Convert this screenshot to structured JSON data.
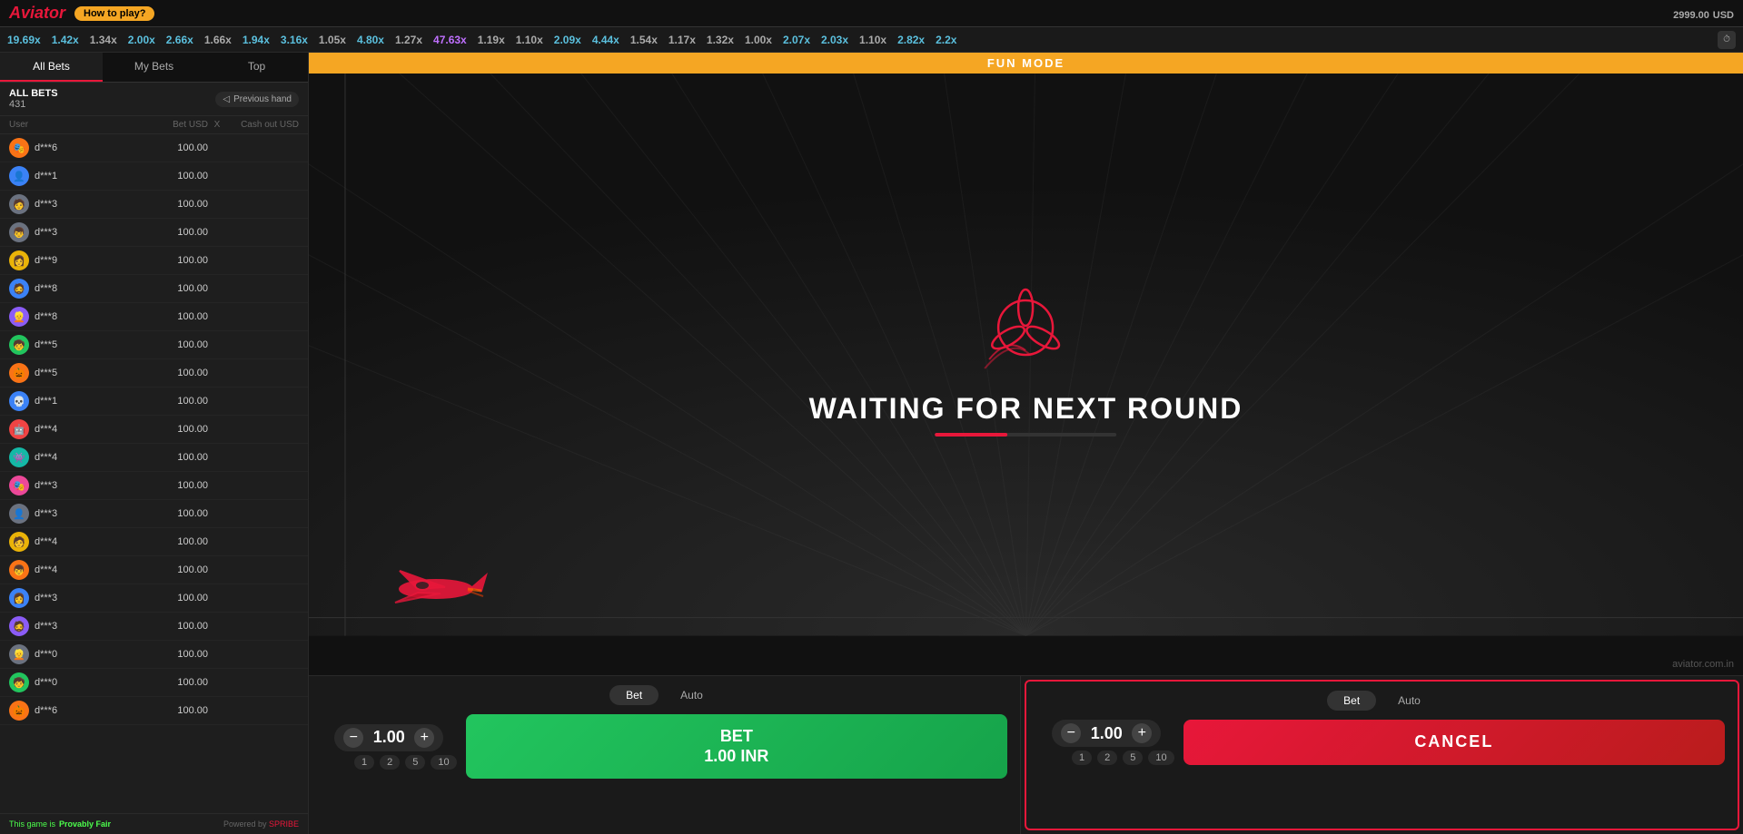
{
  "topbar": {
    "logo": "Aviator",
    "how_to_play": "How to play?",
    "balance": "2999.00",
    "currency": "USD"
  },
  "multiplier_bar": {
    "items": [
      {
        "value": "19.69x",
        "color": "blue"
      },
      {
        "value": "1.42x",
        "color": "blue"
      },
      {
        "value": "1.34x",
        "color": "gray"
      },
      {
        "value": "2.00x",
        "color": "blue"
      },
      {
        "value": "2.66x",
        "color": "blue"
      },
      {
        "value": "1.66x",
        "color": "gray"
      },
      {
        "value": "1.94x",
        "color": "blue"
      },
      {
        "value": "3.16x",
        "color": "blue"
      },
      {
        "value": "1.05x",
        "color": "gray"
      },
      {
        "value": "4.80x",
        "color": "blue"
      },
      {
        "value": "1.27x",
        "color": "gray"
      },
      {
        "value": "47.63x",
        "color": "purple"
      },
      {
        "value": "1.19x",
        "color": "gray"
      },
      {
        "value": "1.10x",
        "color": "gray"
      },
      {
        "value": "2.09x",
        "color": "blue"
      },
      {
        "value": "4.44x",
        "color": "blue"
      },
      {
        "value": "1.54x",
        "color": "gray"
      },
      {
        "value": "1.17x",
        "color": "gray"
      },
      {
        "value": "1.32x",
        "color": "gray"
      },
      {
        "value": "1.00x",
        "color": "gray"
      },
      {
        "value": "2.07x",
        "color": "blue"
      },
      {
        "value": "2.03x",
        "color": "blue"
      },
      {
        "value": "1.10x",
        "color": "gray"
      },
      {
        "value": "2.82x",
        "color": "blue"
      },
      {
        "value": "2.2x",
        "color": "blue"
      }
    ]
  },
  "sidebar": {
    "tabs": [
      "All Bets",
      "My Bets",
      "Top"
    ],
    "active_tab": "All Bets",
    "all_bets_label": "ALL BETS",
    "bets_count": "431",
    "prev_hand_label": "Previous hand",
    "columns": {
      "user": "User",
      "bet": "Bet USD",
      "x": "X",
      "cashout": "Cash out USD"
    },
    "bets": [
      {
        "user": "d***6",
        "amount": "100.00",
        "avatar_color": "av-orange"
      },
      {
        "user": "d***1",
        "amount": "100.00",
        "avatar_color": "av-blue"
      },
      {
        "user": "d***3",
        "amount": "100.00",
        "avatar_color": "av-gray"
      },
      {
        "user": "d***3",
        "amount": "100.00",
        "avatar_color": "av-gray"
      },
      {
        "user": "d***9",
        "amount": "100.00",
        "avatar_color": "av-yellow"
      },
      {
        "user": "d***8",
        "amount": "100.00",
        "avatar_color": "av-blue"
      },
      {
        "user": "d***8",
        "amount": "100.00",
        "avatar_color": "av-purple"
      },
      {
        "user": "d***5",
        "amount": "100.00",
        "avatar_color": "av-green"
      },
      {
        "user": "d***5",
        "amount": "100.00",
        "avatar_color": "av-orange"
      },
      {
        "user": "d***1",
        "amount": "100.00",
        "avatar_color": "av-blue"
      },
      {
        "user": "d***4",
        "amount": "100.00",
        "avatar_color": "av-red"
      },
      {
        "user": "d***4",
        "amount": "100.00",
        "avatar_color": "av-teal"
      },
      {
        "user": "d***3",
        "amount": "100.00",
        "avatar_color": "av-pink"
      },
      {
        "user": "d***3",
        "amount": "100.00",
        "avatar_color": "av-gray"
      },
      {
        "user": "d***4",
        "amount": "100.00",
        "avatar_color": "av-yellow"
      },
      {
        "user": "d***4",
        "amount": "100.00",
        "avatar_color": "av-orange"
      },
      {
        "user": "d***3",
        "amount": "100.00",
        "avatar_color": "av-blue"
      },
      {
        "user": "d***3",
        "amount": "100.00",
        "avatar_color": "av-purple"
      },
      {
        "user": "d***0",
        "amount": "100.00",
        "avatar_color": "av-gray"
      },
      {
        "user": "d***0",
        "amount": "100.00",
        "avatar_color": "av-green"
      },
      {
        "user": "d***6",
        "amount": "100.00",
        "avatar_color": "av-orange"
      }
    ],
    "footer": {
      "game_label": "This game is",
      "provably_fair": "Provably Fair",
      "powered_by": "Powered by",
      "spribe": "SPRIBE"
    }
  },
  "game": {
    "fun_mode": "FUN MODE",
    "waiting_text": "WAITING FOR NEXT ROUND",
    "progress": 40
  },
  "bet_panel_1": {
    "tabs": [
      "Bet",
      "Auto"
    ],
    "active_tab": "Bet",
    "amount": "1.00",
    "shortcuts": [
      "1",
      "2",
      "5",
      "10"
    ],
    "btn_label_line1": "BET",
    "btn_label_line2": "1.00 INR"
  },
  "bet_panel_2": {
    "tabs": [
      "Bet",
      "Auto"
    ],
    "active_tab": "Bet",
    "amount": "1.00",
    "shortcuts": [
      "1",
      "2",
      "5",
      "10"
    ],
    "cancel_label": "CANCEL"
  },
  "website": "aviator.com.in"
}
